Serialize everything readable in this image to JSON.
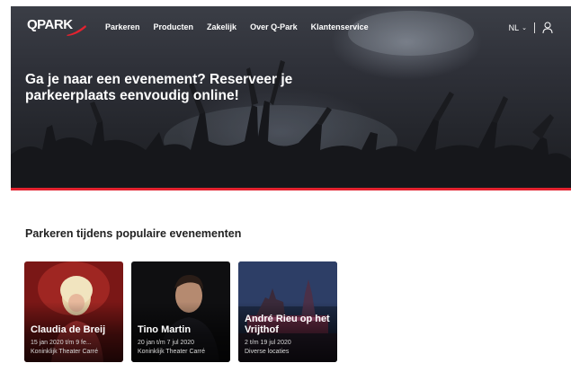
{
  "nav": {
    "logo_text": "QPARK",
    "links": [
      "Parkeren",
      "Producten",
      "Zakelijk",
      "Over Q-Park",
      "Klantenservice"
    ],
    "language": "NL"
  },
  "hero": {
    "title": "Ga je naar een evenement? Reserveer je parkeerplaats eenvoudig online!"
  },
  "section": {
    "title": "Parkeren tijdens populaire evenementen"
  },
  "events": [
    {
      "title": "Claudia de Breij",
      "date": "15 jan 2020 t/m 9 fe...",
      "venue": "Koninklijk Theater Carré"
    },
    {
      "title": "Tino Martin",
      "date": "20 jan t/m 7 jul 2020",
      "venue": "Koninklijk Theater Carré"
    },
    {
      "title": "André Rieu op het Vrijthof",
      "date": "2 t/m 19 jul 2020",
      "venue": "Diverse locaties"
    }
  ],
  "colors": {
    "brand_red": "#e3222f",
    "hero_dark": "#2a2c33"
  }
}
